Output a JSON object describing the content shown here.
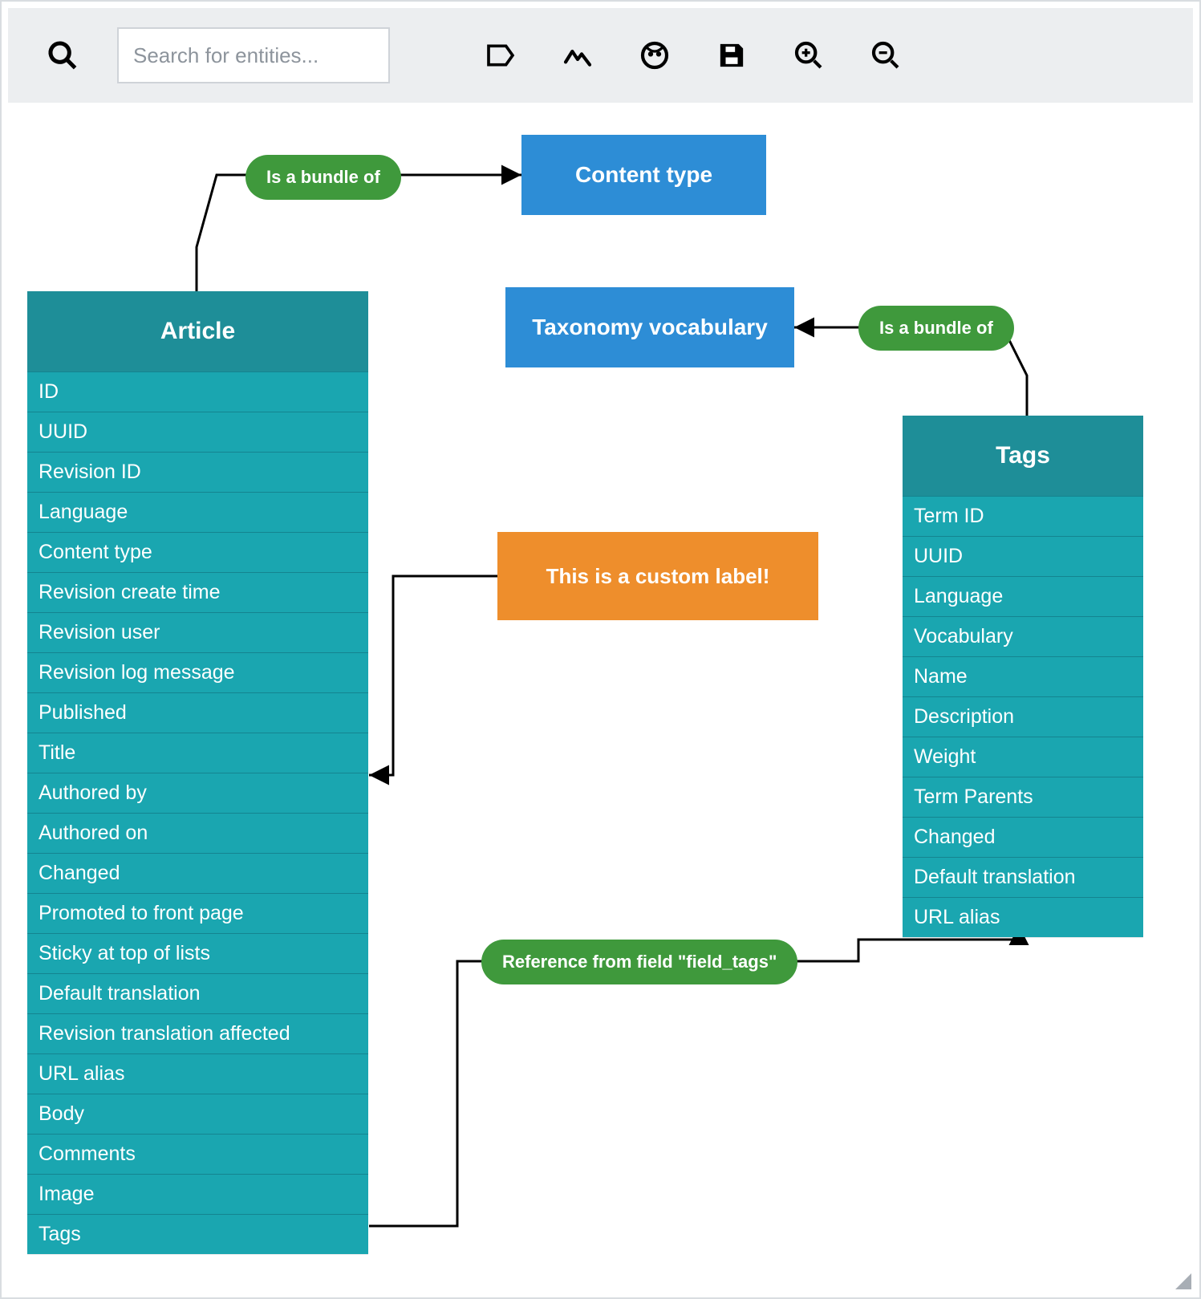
{
  "toolbar": {
    "search": {
      "placeholder": "Search for entities..."
    },
    "buttons": {
      "search": "search-icon",
      "label": "label-icon",
      "timeline": "timeline-icon",
      "face": "face-icon",
      "save": "save-icon",
      "zoom_in": "zoom-in-icon",
      "zoom_out": "zoom-out-icon"
    }
  },
  "entities": {
    "article": {
      "title": "Article",
      "fields": [
        "ID",
        "UUID",
        "Revision ID",
        "Language",
        "Content type",
        "Revision create time",
        "Revision user",
        "Revision log message",
        "Published",
        "Title",
        "Authored by",
        "Authored on",
        "Changed",
        "Promoted to front page",
        "Sticky at top of lists",
        "Default translation",
        "Revision translation affected",
        "URL alias",
        "Body",
        "Comments",
        "Image",
        "Tags"
      ]
    },
    "tags": {
      "title": "Tags",
      "fields": [
        "Term ID",
        "UUID",
        "Language",
        "Vocabulary",
        "Name",
        "Description",
        "Weight",
        "Term Parents",
        "Changed",
        "Default translation",
        "URL alias"
      ]
    }
  },
  "blocks": {
    "content_type": "Content type",
    "taxonomy_vocab": "Taxonomy vocabulary"
  },
  "edge_labels": {
    "bundle_article": "Is a bundle of",
    "bundle_tags": "Is a bundle of",
    "ref_field_tags": "Reference from field \"field_tags\""
  },
  "annotation": {
    "custom_label": "This is a custom label!"
  }
}
